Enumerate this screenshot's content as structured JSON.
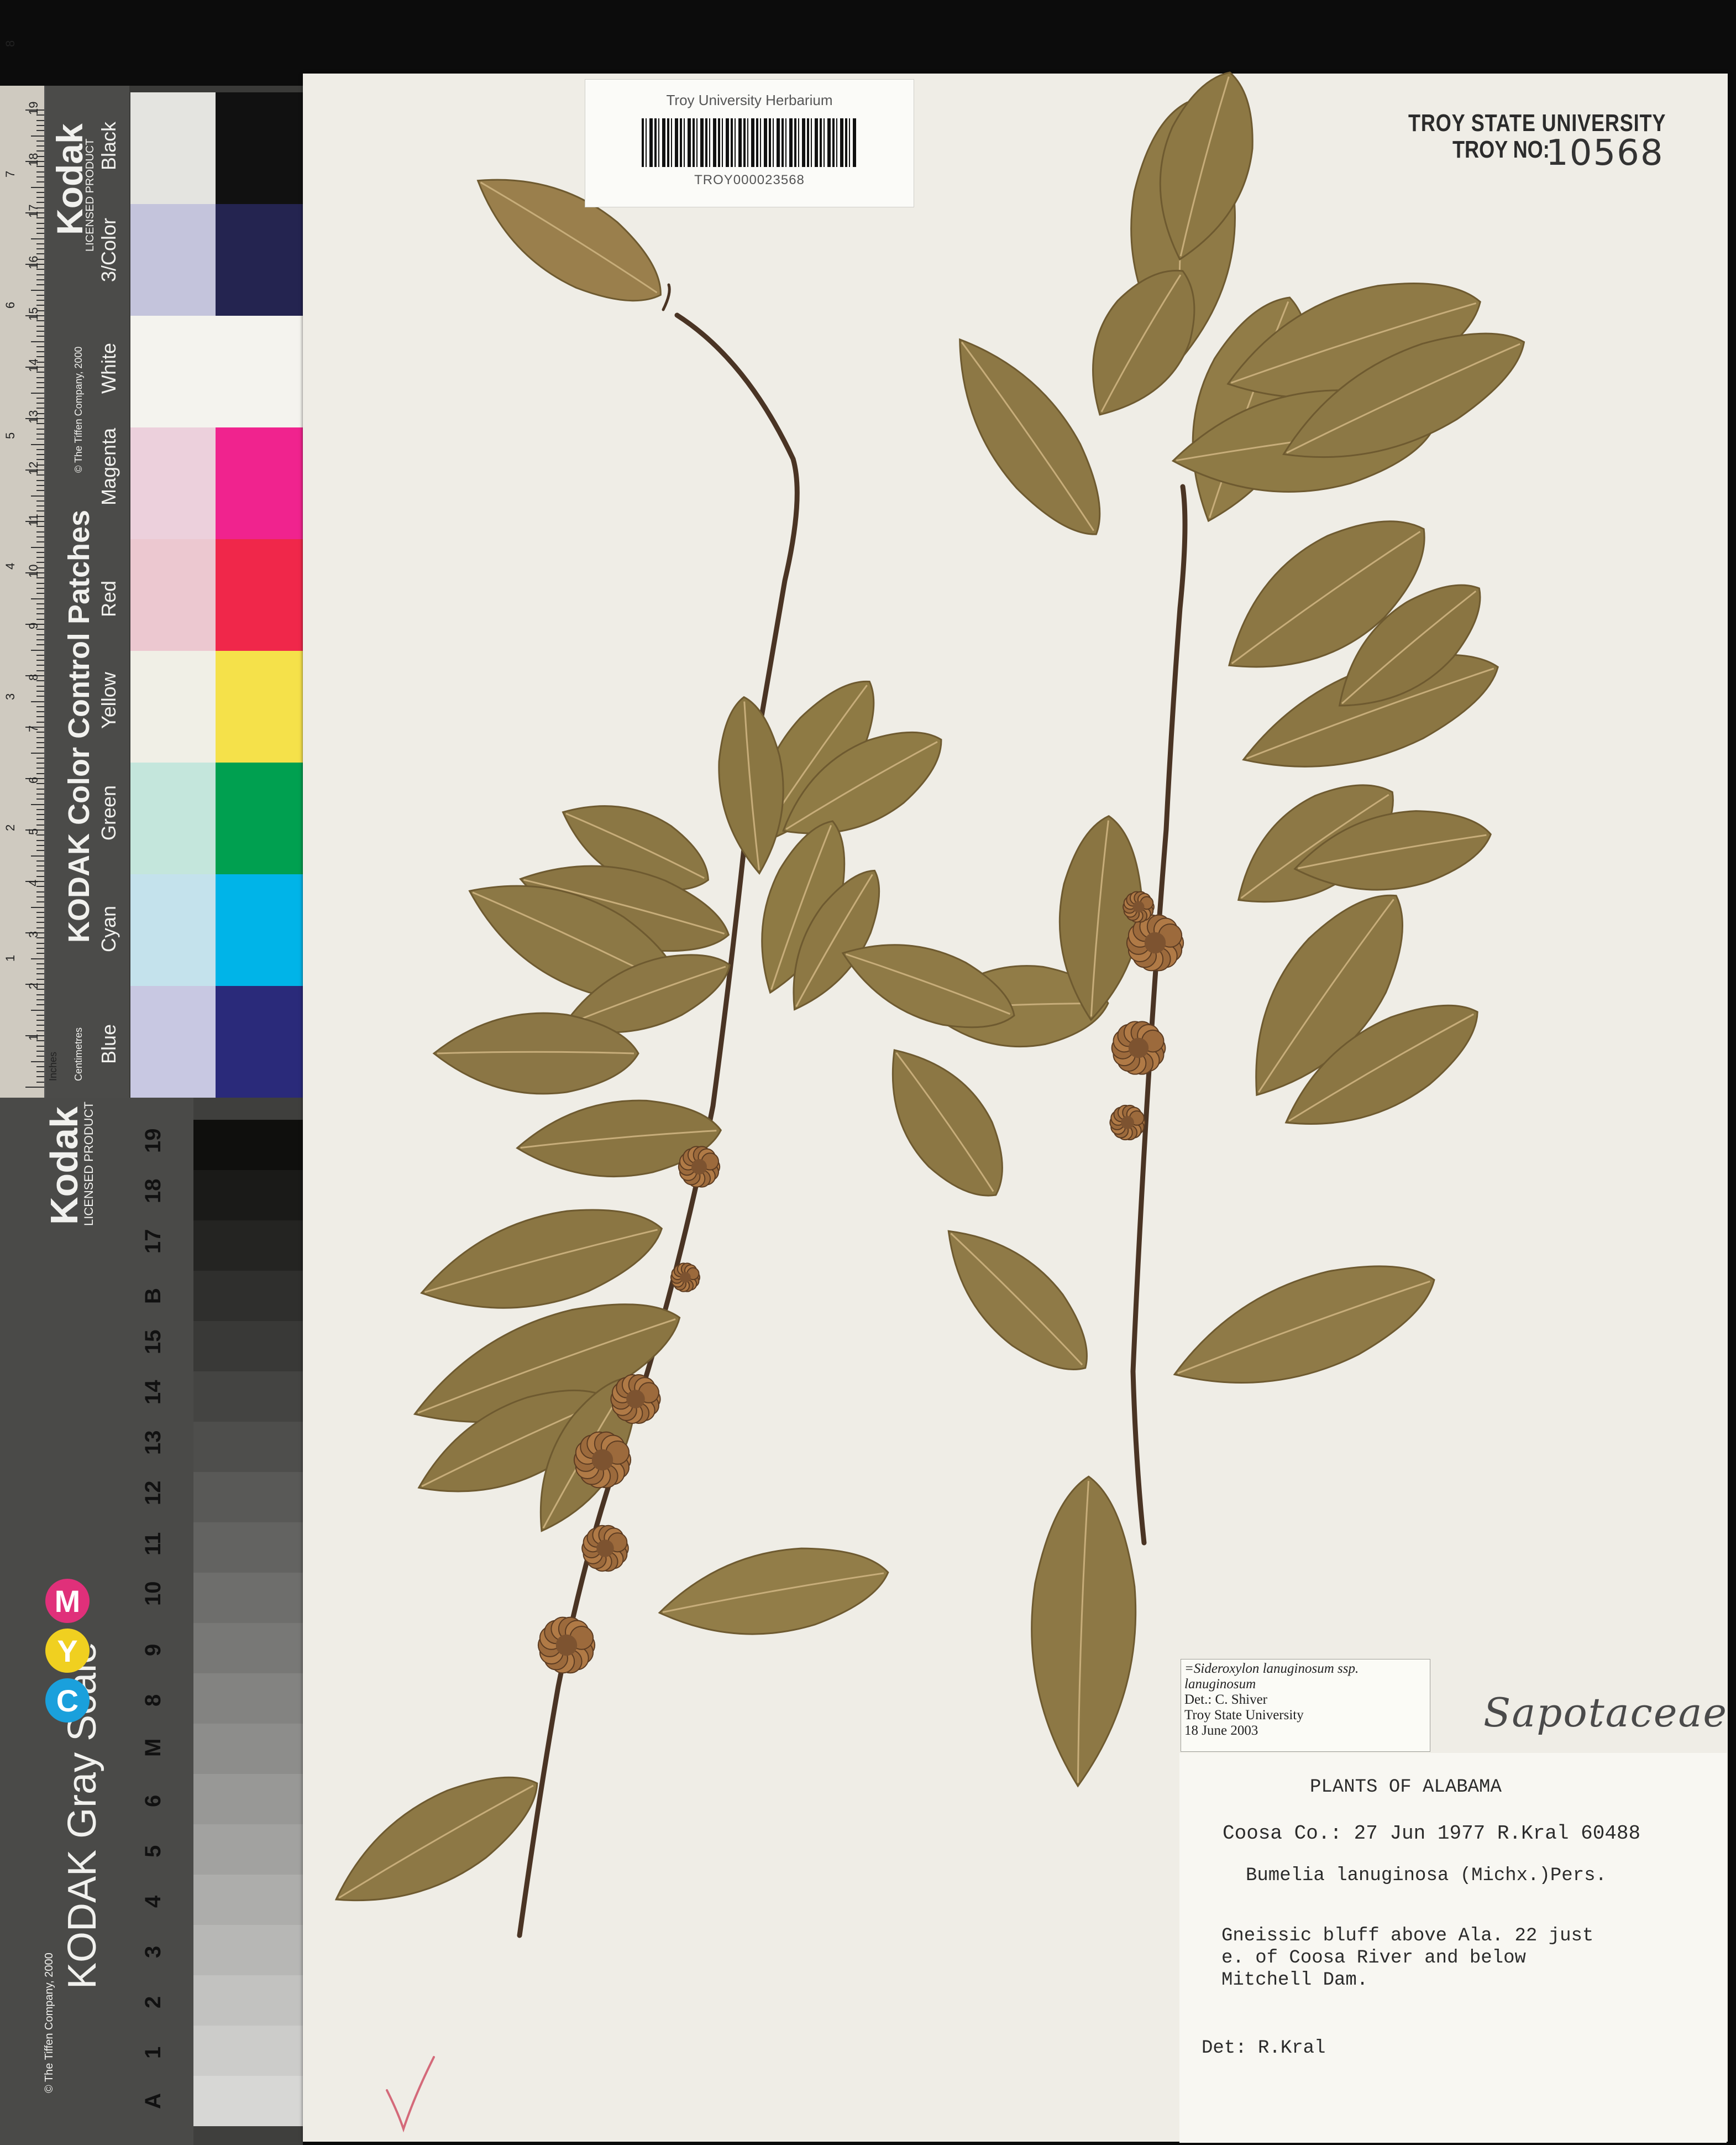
{
  "color_card": {
    "ruler_units_top": "Inches",
    "ruler_units_bottom": "Centimetres",
    "brand": "Kodak",
    "licensed": "LICENSED PRODUCT",
    "title": "KODAK Color Control Patches",
    "copyright": "© The Tiffen Company, 2000",
    "patch_labels": [
      "Blue",
      "Cyan",
      "Green",
      "Yellow",
      "Red",
      "Magenta",
      "White",
      "3/Color",
      "Black"
    ],
    "cm_ticks": [
      "1",
      "2",
      "3",
      "4",
      "5",
      "6",
      "7",
      "8",
      "9",
      "10",
      "11",
      "12",
      "13",
      "14",
      "15",
      "16",
      "17",
      "18",
      "19"
    ],
    "inch_ticks": [
      "1",
      "2",
      "3",
      "4",
      "5",
      "6",
      "7",
      "8"
    ],
    "patch_colors": {
      "dark": [
        "#2a2a7a",
        "#00b4e8",
        "#00a050",
        "#f5e14a",
        "#f0274a",
        "#f0238e",
        "#f4f3ee",
        "#242450",
        "#111111"
      ],
      "light": [
        "#c8c8e2",
        "#c4e2ec",
        "#c4e6dc",
        "#f0efe6",
        "#ecc8d0",
        "#ecd0dc",
        "#f4f3ee",
        "#c4c4dc",
        "#e4e4e0"
      ]
    }
  },
  "gray_card": {
    "brand": "Kodak",
    "licensed": "LICENSED PRODUCT",
    "title": "KODAK Gray Scale",
    "copyright": "© The Tiffen Company, 2000",
    "cmy": [
      "C",
      "Y",
      "M"
    ],
    "steps": [
      "A",
      "1",
      "2",
      "3",
      "4",
      "5",
      "6",
      "M",
      "8",
      "9",
      "10",
      "11",
      "12",
      "13",
      "14",
      "15",
      "B",
      "17",
      "18",
      "19"
    ]
  },
  "barcode_label": {
    "institution": "Troy University Herbarium",
    "code": "TROY000023568"
  },
  "stamp": {
    "line1": "TROY STATE UNIVERSITY",
    "line2": "TROY NO:",
    "number": "10568"
  },
  "annotation": {
    "line1": "=Sideroxylon lanuginosum ssp.",
    "line2": "lanuginosum",
    "line3": "Det.: C. Shiver",
    "line4": "Troy State University",
    "line5": "18 June 2003"
  },
  "family": "Sapotaceae",
  "main_label": {
    "header": "PLANTS OF ALABAMA",
    "collection": "Coosa Co.: 27 Jun 1977 R.Kral 60488",
    "taxon": "Bumelia lanuginosa (Michx.)Pers.",
    "locality_1": "Gneissic bluff above Ala. 22 just",
    "locality_2": "e. of Coosa River and below",
    "locality_3": "Mitchell Dam.",
    "determiner": "Det: R.Kral"
  }
}
